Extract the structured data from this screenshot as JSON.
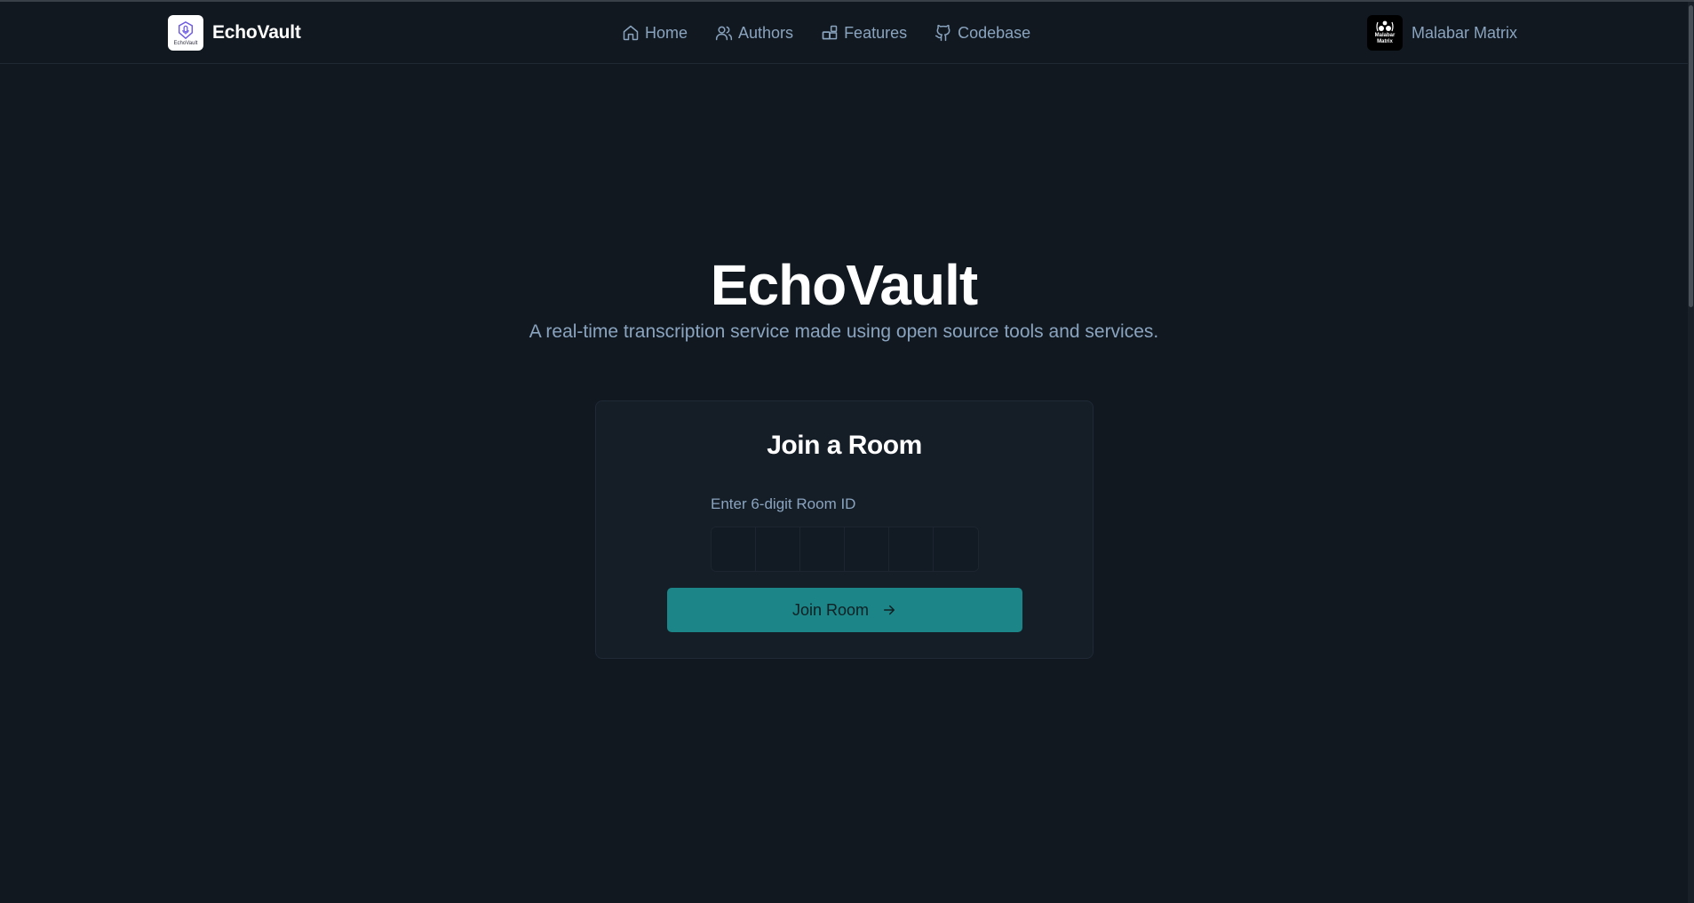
{
  "header": {
    "brand_name": "EchoVault",
    "logo_text": "EchoVault",
    "nav": [
      {
        "label": "Home",
        "icon": "home-icon"
      },
      {
        "label": "Authors",
        "icon": "users-icon"
      },
      {
        "label": "Features",
        "icon": "blocks-icon"
      },
      {
        "label": "Codebase",
        "icon": "github-icon"
      }
    ],
    "org_name": "Malabar Matrix",
    "org_avatar_text": [
      "Malabar",
      "Matrix"
    ]
  },
  "hero": {
    "title": "EchoVault",
    "subtitle": "A real-time transcription service made using open source tools and services."
  },
  "join_card": {
    "title": "Join a Room",
    "input_label": "Enter 6-digit Room ID",
    "digits": [
      "",
      "",
      "",
      "",
      "",
      ""
    ],
    "button_label": "Join Room",
    "button_icon": "arrow-right-icon"
  },
  "colors": {
    "background": "#111820",
    "accent": "#1b8587",
    "muted_text": "#8aa4bf"
  }
}
